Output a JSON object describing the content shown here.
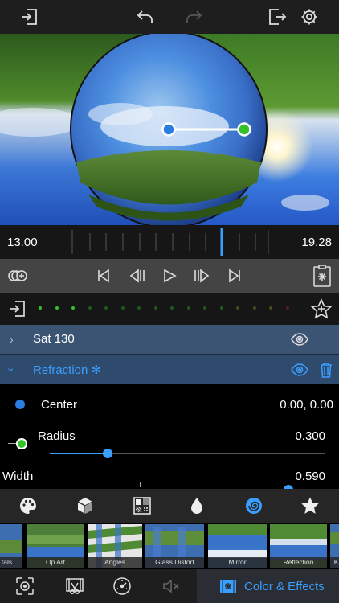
{
  "timeline": {
    "start": "13.00",
    "end": "19.28"
  },
  "layers": [
    {
      "label": "Sat 130",
      "expanded": false
    },
    {
      "label": "Refraction ✻",
      "expanded": true
    }
  ],
  "params": {
    "center": {
      "label": "Center",
      "value": "0.00, 0.00"
    },
    "radius": {
      "label": "Radius",
      "value": "0.300",
      "level": 0.3
    },
    "width": {
      "label": "Width",
      "value": "0.590",
      "level": 0.59
    }
  },
  "effects": [
    {
      "label": "tals"
    },
    {
      "label": "Op Art"
    },
    {
      "label": "Angles"
    },
    {
      "label": "Glass Distort"
    },
    {
      "label": "Mirror"
    },
    {
      "label": "Reflection"
    },
    {
      "label": "Ka"
    }
  ],
  "bottom": {
    "active_label": "Color & Effects"
  },
  "colors": {
    "accent": "#3a9fff",
    "green": "#35c12b",
    "layer_active": "#2e4d70",
    "layer_inactive": "#3a5270"
  }
}
